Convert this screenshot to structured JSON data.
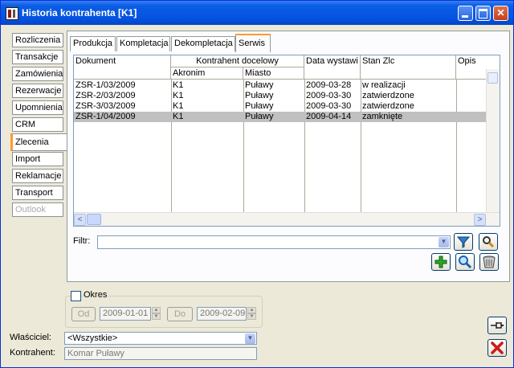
{
  "window": {
    "title": "Historia kontrahenta [K1]"
  },
  "sidebar": {
    "tabs": [
      {
        "label": "Rozliczenia"
      },
      {
        "label": "Transakcje"
      },
      {
        "label": "Zamówienia"
      },
      {
        "label": "Rezerwacje"
      },
      {
        "label": "Upomnienia"
      },
      {
        "label": "CRM"
      },
      {
        "label": "Zlecenia"
      },
      {
        "label": "Import"
      },
      {
        "label": "Reklamacje"
      },
      {
        "label": "Transport"
      },
      {
        "label": "Outlook"
      }
    ],
    "active": "Zlecenia"
  },
  "tabs": [
    {
      "label": "Produkcja"
    },
    {
      "label": "Kompletacja"
    },
    {
      "label": "Dekompletacja"
    },
    {
      "label": "Serwis"
    }
  ],
  "grid": {
    "headers": {
      "dokument": "Dokument",
      "kontrahent_group": "Kontrahent docelowy",
      "akronim": "Akronim",
      "miasto": "Miasto",
      "data": "Data wystawi",
      "stan": "Stan Zlc",
      "opis": "Opis"
    },
    "rows": [
      {
        "dokument": "ZSR-1/03/2009",
        "akronim": "K1",
        "miasto": "Puławy",
        "data": "2009-03-28",
        "stan": "w realizacji",
        "selected": false
      },
      {
        "dokument": "ZSR-2/03/2009",
        "akronim": "K1",
        "miasto": "Puławy",
        "data": "2009-03-30",
        "stan": "zatwierdzone",
        "selected": false
      },
      {
        "dokument": "ZSR-3/03/2009",
        "akronim": "K1",
        "miasto": "Puławy",
        "data": "2009-03-30",
        "stan": "zatwierdzone",
        "selected": false
      },
      {
        "dokument": "ZSR-1/04/2009",
        "akronim": "K1",
        "miasto": "Puławy",
        "data": "2009-04-14",
        "stan": "zamknięte",
        "selected": true
      }
    ]
  },
  "filter": {
    "label": "Filtr:",
    "value": ""
  },
  "okres": {
    "label": "Okres",
    "checked": false,
    "od_label": "Od",
    "od_value": "2009-01-01",
    "do_label": "Do",
    "do_value": "2009-02-09"
  },
  "wlasciciel": {
    "label": "Właściciel:",
    "value": "<Wszystkie>"
  },
  "kontrahent": {
    "label": "Kontrahent:",
    "value": "Komar Puławy"
  },
  "colors": {
    "accent": "#ff9b2e",
    "titlebar": "#0553e0",
    "selected_row": "#c0c0c0"
  }
}
